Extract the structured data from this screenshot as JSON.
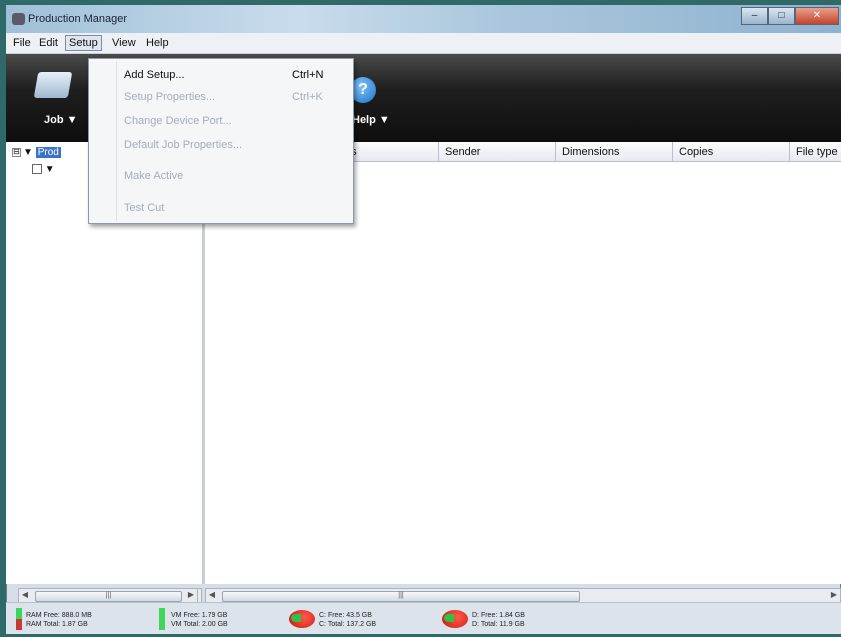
{
  "window": {
    "title": "Production Manager"
  },
  "menubar": {
    "items": [
      "File",
      "Edit",
      "Setup",
      "View",
      "Help"
    ],
    "active": "Setup"
  },
  "toolbar": {
    "job_label": "Job",
    "help_label": "Help"
  },
  "setup_menu": {
    "items": [
      {
        "label": "Add Setup...",
        "shortcut": "Ctrl+N",
        "enabled": true
      },
      {
        "label": "Setup Properties...",
        "shortcut": "Ctrl+K",
        "enabled": false
      },
      {
        "label": "Change Device Port...",
        "shortcut": "",
        "enabled": false
      },
      {
        "label": "Default Job Properties...",
        "shortcut": "",
        "enabled": false
      },
      {
        "label": "Make Active",
        "shortcut": "",
        "enabled": false
      },
      {
        "label": "Test Cut",
        "shortcut": "",
        "enabled": false
      }
    ]
  },
  "tree": {
    "root_label": "Prod",
    "root_expander": "⊟"
  },
  "table": {
    "columns": [
      "us",
      "Sender",
      "Dimensions",
      "Copies",
      "File type"
    ]
  },
  "status": {
    "ram_free": "RAM Free: 888.0 MB",
    "ram_total": "RAM Total: 1.87 GB",
    "vm_free": "VM Free: 1.79 GB",
    "vm_total": "VM Total: 2.00 GB",
    "c_free": "C: Free: 43.5 GB",
    "c_total": "C: Total: 137.2 GB",
    "d_free": "D: Free: 1.84 GB",
    "d_total": "D: Total: 11.9 GB"
  },
  "colors": {
    "accent": "#3a74c8",
    "toolbar_bg": "#1f1f1f",
    "disabled_text": "#a5adb8"
  }
}
